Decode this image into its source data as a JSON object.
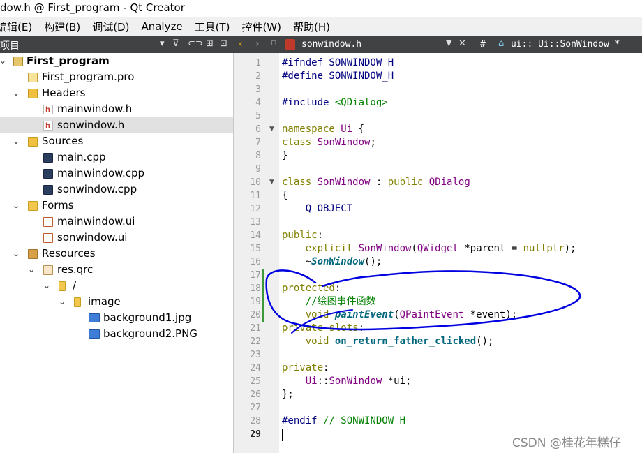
{
  "window": {
    "title": "dow.h @ First_program - Qt Creator"
  },
  "menu": [
    "编辑(E)",
    "构建(B)",
    "调试(D)",
    "Analyze",
    "工具(T)",
    "控件(W)",
    "帮助(H)"
  ],
  "left_panel": {
    "title": "项目",
    "tree": [
      {
        "label": "First_program",
        "bold": true
      },
      {
        "label": "First_program.pro"
      },
      {
        "label": "Headers"
      },
      {
        "label": "mainwindow.h"
      },
      {
        "label": "sonwindow.h",
        "selected": true
      },
      {
        "label": "Sources"
      },
      {
        "label": "main.cpp"
      },
      {
        "label": "mainwindow.cpp"
      },
      {
        "label": "sonwindow.cpp"
      },
      {
        "label": "Forms"
      },
      {
        "label": "mainwindow.ui"
      },
      {
        "label": "sonwindow.ui"
      },
      {
        "label": "Resources"
      },
      {
        "label": "res.qrc"
      },
      {
        "label": "/"
      },
      {
        "label": "image"
      },
      {
        "label": "background1.jpg"
      },
      {
        "label": "background2.PNG"
      }
    ]
  },
  "editor": {
    "filename": "sonwindow.h",
    "symbol": "ui:: Ui::SonWindow *",
    "hash": "#",
    "current_line": 29
  },
  "watermark": "CSDN @桂花年糕仔",
  "colors": {
    "toolbar": "#404244",
    "selection": "#e1e1e1",
    "annotation": "#0000e0"
  }
}
